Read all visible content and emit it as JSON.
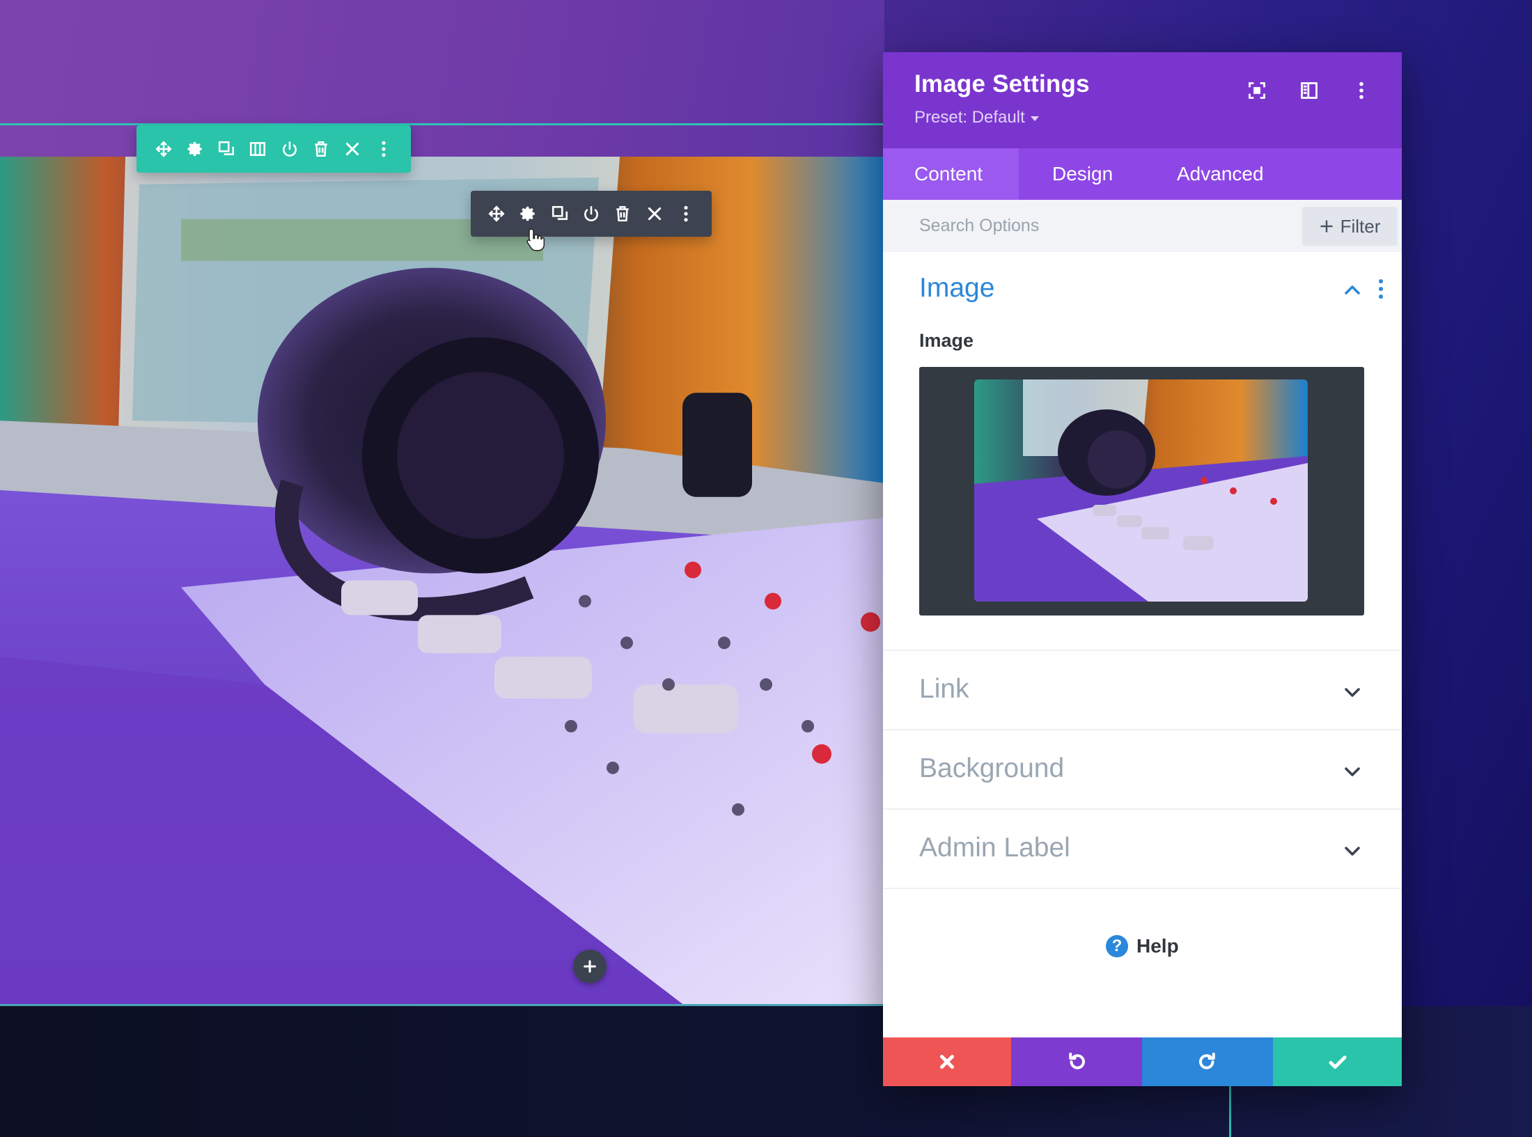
{
  "panel": {
    "title": "Image Settings",
    "preset": "Preset: Default",
    "tabs": [
      "Content",
      "Design",
      "Advanced"
    ],
    "search": {
      "placeholder": "Search Options"
    },
    "filter_label": "Filter",
    "sections": {
      "image": {
        "title": "Image",
        "field_label": "Image"
      },
      "link": "Link",
      "background": "Background",
      "admin_label": "Admin Label"
    },
    "help": "Help",
    "header_icons": [
      "focus-mode-icon",
      "split-view-icon",
      "kebab-menu-icon"
    ],
    "footer_icons": [
      "close-icon",
      "undo-icon",
      "redo-icon",
      "check-icon"
    ]
  },
  "row_toolbar_icons": [
    "move-icon",
    "gear-icon",
    "duplicate-icon",
    "columns-icon",
    "power-icon",
    "trash-icon",
    "close-icon",
    "kebab-menu-icon"
  ],
  "module_toolbar_icons": [
    "move-icon",
    "gear-icon",
    "duplicate-icon",
    "power-icon",
    "trash-icon",
    "close-icon",
    "kebab-menu-icon"
  ],
  "colors": {
    "panel_header": "#7b35cf",
    "tabs_bar": "#8e47e6",
    "row_toolbar": "#29c4a9",
    "module_toolbar": "#3d4350",
    "cancel": "#ef5555",
    "undo": "#7d3bd0",
    "redo": "#2b87da",
    "save": "#29c4a9",
    "section_active": "#2b87da"
  }
}
